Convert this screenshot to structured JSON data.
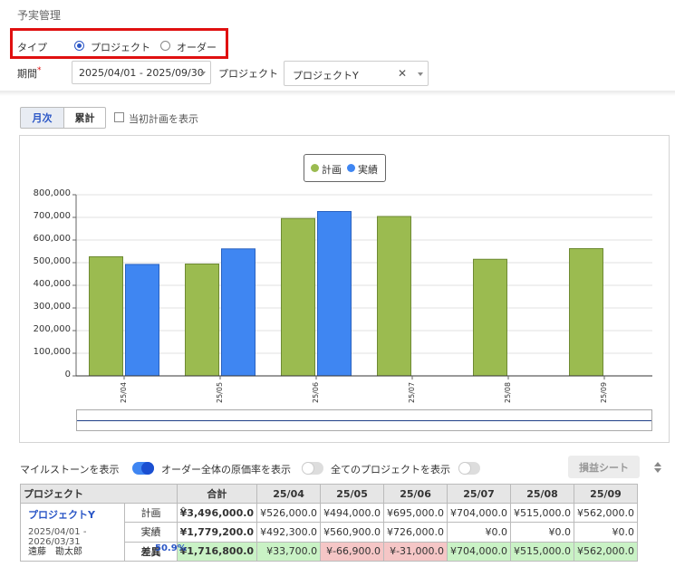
{
  "page_title": "予実管理",
  "filters": {
    "type_label": "タイプ",
    "type_options": [
      "プロジェクト",
      "オーダー"
    ],
    "type_selected": "プロジェクト",
    "period_label": "期間",
    "required_mark": "*",
    "period_value": "2025/04/01 - 2025/09/30",
    "project_label": "プロジェクト",
    "project_value": "プロジェクトY",
    "clear_glyph": "✕"
  },
  "view": {
    "monthly_label": "月次",
    "cumulative_label": "累計",
    "active": "月次",
    "show_initial_plan_label": "当初計画を表示"
  },
  "chart_data": {
    "type": "bar",
    "categories": [
      "25/04",
      "25/05",
      "25/06",
      "25/07",
      "25/08",
      "25/09"
    ],
    "series": [
      {
        "name": "計画",
        "color": "#9bbb50",
        "values": [
          526000,
          494000,
          695000,
          704000,
          515000,
          562000
        ]
      },
      {
        "name": "実績",
        "color": "#3f86f2",
        "values": [
          492300,
          560900,
          726000,
          0,
          0,
          0
        ]
      }
    ],
    "ylim": [
      0,
      800000
    ],
    "yticks": [
      "800,000",
      "700,000",
      "600,000",
      "500,000",
      "400,000",
      "300,000",
      "200,000",
      "100,000",
      "0"
    ],
    "grid": true,
    "legend": "top-center"
  },
  "options": {
    "show_milestones_label": "マイルストーンを表示",
    "show_milestones": true,
    "show_cost_rate_label": "オーダー全体の原価率を表示",
    "show_cost_rate": false,
    "show_all_projects_label": "全てのプロジェクトを表示",
    "show_all_projects": false,
    "pl_sheet_label": "損益シート"
  },
  "table": {
    "project_header": "プロジェクト",
    "total_header": "合計",
    "months": [
      "25/04",
      "25/05",
      "25/06",
      "25/07",
      "25/08",
      "25/09"
    ],
    "project": {
      "name": "プロジェクトY",
      "period": "2025/04/01 - 2026/03/31",
      "manager": "遠藤　勘太郎",
      "rate": "50.9%"
    },
    "rows": [
      {
        "label": "計画",
        "total": "¥3,496,000.0",
        "values": [
          "¥526,000.0",
          "¥494,000.0",
          "¥695,000.0",
          "¥704,000.0",
          "¥515,000.0",
          "¥562,000.0"
        ]
      },
      {
        "label": "実績",
        "total": "¥1,779,200.0",
        "values": [
          "¥492,300.0",
          "¥560,900.0",
          "¥726,000.0",
          "¥0.0",
          "¥0.0",
          "¥0.0"
        ]
      },
      {
        "label": "差異",
        "total": "¥1,716,800.0",
        "values": [
          "¥33,700.0",
          "¥-66,900.0",
          "¥-31,000.0",
          "¥704,000.0",
          "¥515,000.0",
          "¥562,000.0"
        ]
      }
    ],
    "colors": {
      "positive": "#c9f2c5",
      "negative": "#f5c6c6"
    }
  }
}
